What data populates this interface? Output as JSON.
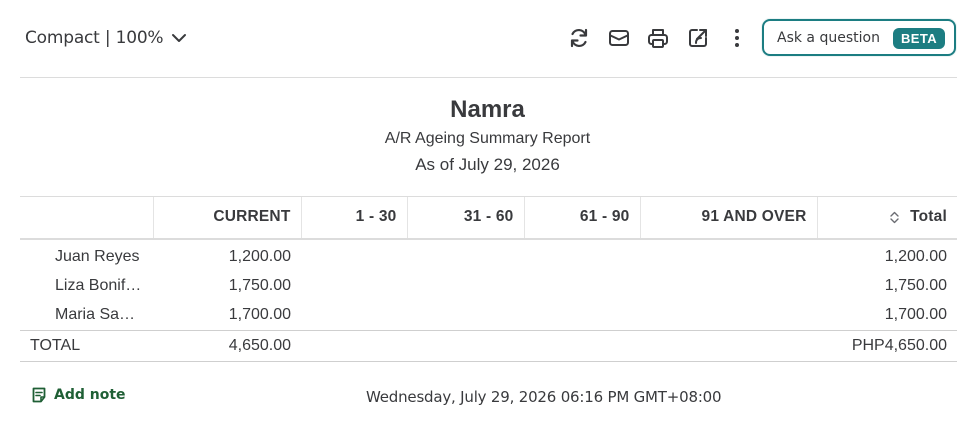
{
  "toolbar": {
    "view_label": "Compact | 100%",
    "icons": [
      "refresh-icon",
      "email-icon",
      "print-icon",
      "export-icon",
      "more-icon"
    ],
    "ask_placeholder": "Ask a question",
    "beta_badge": "BETA"
  },
  "report": {
    "company": "Namra",
    "title": "A/R Ageing Summary Report",
    "as_of": "As of July 29, 2026",
    "columns": [
      "",
      "CURRENT",
      "1 - 30",
      "31 - 60",
      "61 - 90",
      "91 AND OVER",
      "Total"
    ],
    "rows": [
      {
        "name": "Juan Reyes",
        "current": "1,200.00",
        "d1_30": "",
        "d31_60": "",
        "d61_90": "",
        "d91_over": "",
        "total": "1,200.00"
      },
      {
        "name": "Liza Bonif…",
        "current": "1,750.00",
        "d1_30": "",
        "d31_60": "",
        "d61_90": "",
        "d91_over": "",
        "total": "1,750.00"
      },
      {
        "name": "Maria Sa…",
        "current": "1,700.00",
        "d1_30": "",
        "d31_60": "",
        "d61_90": "",
        "d91_over": "",
        "total": "1,700.00"
      }
    ],
    "total_row": {
      "name": "TOTAL",
      "current": "4,650.00",
      "d1_30": "",
      "d31_60": "",
      "d61_90": "",
      "d91_over": "",
      "total": "PHP4,650.00"
    }
  },
  "footer": {
    "add_note_label": "Add note",
    "timestamp": "Wednesday, July 29, 2026 06:16 PM GMT+08:00"
  },
  "colors": {
    "accent": "#1c7d82",
    "note_green": "#1f5f35",
    "text": "#393a3d"
  }
}
